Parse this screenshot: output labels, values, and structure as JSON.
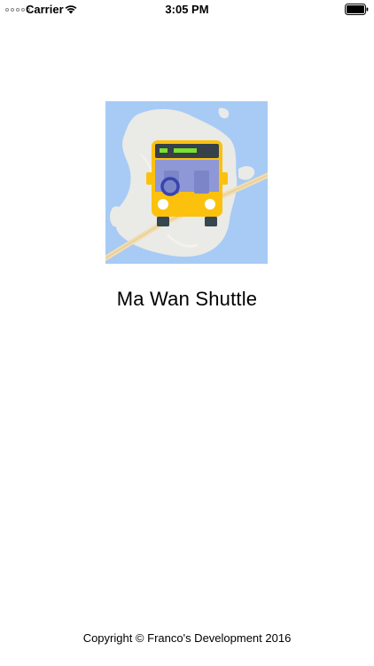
{
  "status_bar": {
    "carrier": "Carrier",
    "time": "3:05 PM",
    "wifi_icon": "wifi-icon",
    "battery_icon": "battery-icon"
  },
  "launch_screen": {
    "app_icon": "bus-on-map-icon",
    "title": "Ma Wan Shuttle",
    "copyright": "Copyright © Franco's Development 2016"
  },
  "colors": {
    "map_water": "#a7cbf5",
    "map_land": "#eaeae6",
    "road": "#f1ddb0",
    "bus_body": "#fcc10d",
    "bus_window": "#8f98d6",
    "bus_sign": "#36414a",
    "bus_sign_led": "#7be030",
    "steering_wheel": "#3943b0",
    "bus_wheels": "#37474f"
  }
}
